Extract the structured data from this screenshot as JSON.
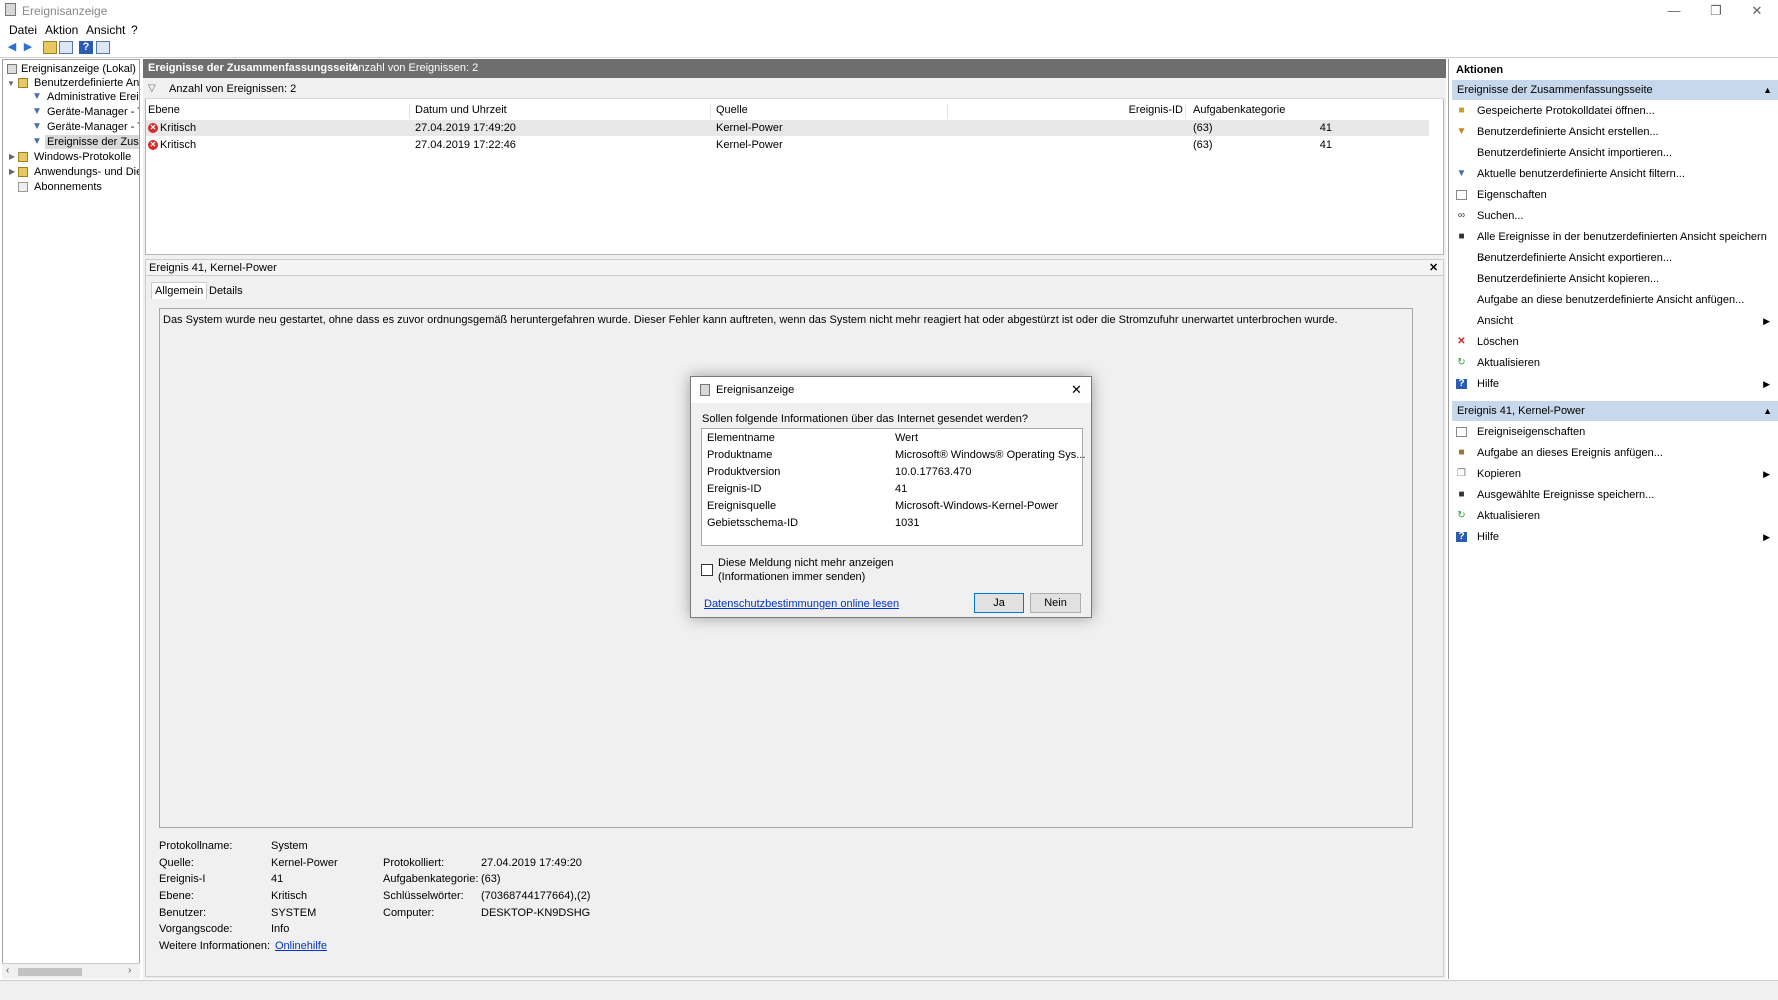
{
  "window": {
    "title": "Ereignisanzeige"
  },
  "menu": {
    "file": "Datei",
    "action": "Aktion",
    "view": "Ansicht",
    "help": "?"
  },
  "tree": {
    "root": "Ereignisanzeige (Lokal)",
    "custom_views": "Benutzerdefinierte Ans",
    "items": [
      "Administrative Ereig",
      "Geräte-Manager - T",
      "Geräte-Manager - T",
      "Ereignisse der Zusar"
    ],
    "windows_logs": "Windows-Protokolle",
    "app_logs": "Anwendungs- und Dier",
    "subscriptions": "Abonnements"
  },
  "main": {
    "header_title": "Ereignisse der Zusammenfassungsseite",
    "header_count": "Anzahl von Ereignissen: 2",
    "filter_count": "Anzahl von Ereignissen: 2",
    "columns": [
      "Ebene",
      "Datum und Uhrzeit",
      "Quelle",
      "Ereignis-ID",
      "Aufgabenkategorie"
    ],
    "rows": [
      {
        "level": "Kritisch",
        "datetime": "27.04.2019 17:49:20",
        "source": "Kernel-Power",
        "id": "41",
        "category": "(63)"
      },
      {
        "level": "Kritisch",
        "datetime": "27.04.2019 17:22:46",
        "source": "Kernel-Power",
        "id": "41",
        "category": "(63)"
      }
    ]
  },
  "detail": {
    "header": "Ereignis 41, Kernel-Power",
    "tab_general": "Allgemein",
    "tab_details": "Details",
    "description": "Das System wurde neu gestartet, ohne dass es zuvor ordnungsgemäß heruntergefahren wurde. Dieser Fehler kann auftreten, wenn das System nicht mehr reagiert hat oder abgestürzt ist oder die Stromzufuhr unerwartet unterbrochen wurde.",
    "props_left": [
      {
        "label": "Protokollname:",
        "value": "System"
      },
      {
        "label": "Quelle:",
        "value": "Kernel-Power"
      },
      {
        "label": "Ereignis-I",
        "value": "41"
      },
      {
        "label": "Ebene:",
        "value": "Kritisch"
      },
      {
        "label": "Benutzer:",
        "value": "SYSTEM"
      },
      {
        "label": "Vorgangscode:",
        "value": "Info"
      },
      {
        "label": "Weitere Informationen:",
        "value": "Onlinehilfe"
      }
    ],
    "props_right": [
      {
        "label": "Protokolliert:",
        "value": "27.04.2019 17:49:20"
      },
      {
        "label": "Aufgabenkategorie:",
        "value": "(63)"
      },
      {
        "label": "Schlüsselwörter:",
        "value": "(70368744177664),(2)"
      },
      {
        "label": "Computer:",
        "value": "DESKTOP-KN9DSHG"
      }
    ]
  },
  "actions": {
    "title": "Aktionen",
    "section1": "Ereignisse der Zusammenfassungsseite",
    "items1": [
      "Gespeicherte Protokolldatei öffnen...",
      "Benutzerdefinierte Ansicht erstellen...",
      "Benutzerdefinierte Ansicht importieren...",
      "Aktuelle benutzerdefinierte Ansicht filtern...",
      "Eigenschaften",
      "Suchen...",
      "Alle Ereignisse in der benutzerdefinierten Ansicht speichern ...",
      "Benutzerdefinierte Ansicht exportieren...",
      "Benutzerdefinierte Ansicht kopieren...",
      "Aufgabe an diese benutzerdefinierte Ansicht anfügen...",
      "Ansicht",
      "Löschen",
      "Aktualisieren",
      "Hilfe"
    ],
    "section2": "Ereignis 41, Kernel-Power",
    "items2": [
      "Ereigniseigenschaften",
      "Aufgabe an dieses Ereignis anfügen...",
      "Kopieren",
      "Ausgewählte Ereignisse speichern...",
      "Aktualisieren",
      "Hilfe"
    ]
  },
  "dialog": {
    "title": "Ereignisanzeige",
    "question": "Sollen folgende Informationen über das Internet gesendet werden?",
    "col_name": "Elementname",
    "col_value": "Wert",
    "rows": [
      {
        "name": "Produktname",
        "value": "Microsoft® Windows® Operating Sys..."
      },
      {
        "name": "Produktversion",
        "value": "10.0.17763.470"
      },
      {
        "name": "Ereignis-ID",
        "value": "41"
      },
      {
        "name": "Ereignisquelle",
        "value": "Microsoft-Windows-Kernel-Power"
      },
      {
        "name": "Gebietsschema-ID",
        "value": "1031"
      }
    ],
    "checkbox_line1": "Diese Meldung nicht mehr anzeigen",
    "checkbox_line2": "(Informationen immer senden)",
    "privacy_link": "Datenschutzbestimmungen online lesen",
    "yes": "Ja",
    "no": "Nein"
  }
}
